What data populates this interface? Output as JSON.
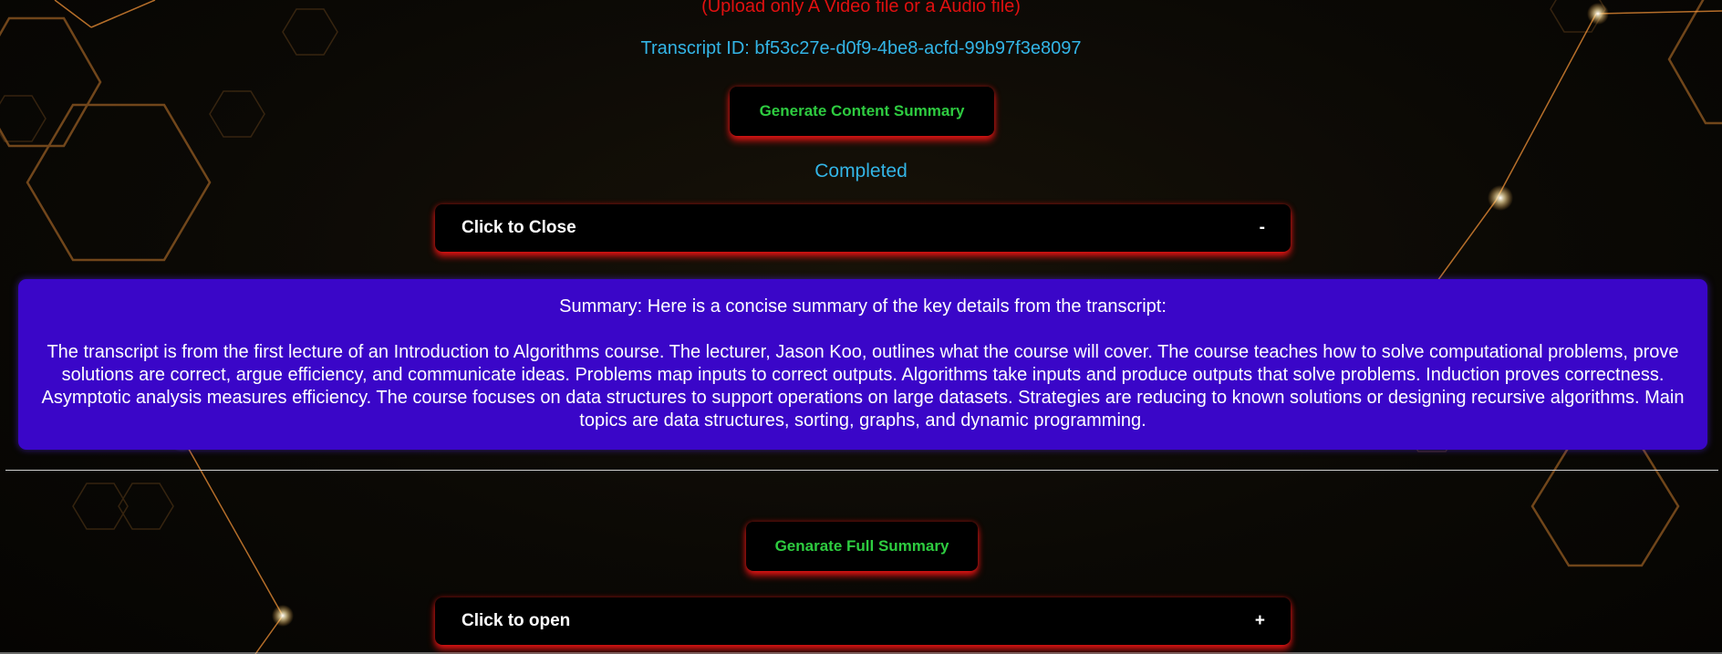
{
  "upload_note": "(Upload only A Video file or a Audio file)",
  "transcript_id": "Transcript ID: bf53c27e-d0f9-4be8-acfd-99b97f3e8097",
  "buttons": {
    "generate_content_summary": "Generate Content Summary",
    "generate_full_summary": "Genarate Full Summary"
  },
  "status": "Completed",
  "accordion_close": {
    "label": "Click to Close",
    "toggle": "-"
  },
  "summary": {
    "title": "Summary: Here is a concise summary of the key details from the transcript:",
    "body": "The transcript is from the first lecture of an Introduction to Algorithms course. The lecturer, Jason Koo, outlines what the course will cover. The course teaches how to solve computational problems, prove solutions are correct, argue efficiency, and communicate ideas. Problems map inputs to correct outputs. Algorithms take inputs and produce outputs that solve problems. Induction proves correctness. Asymptotic analysis measures efficiency. The course focuses on data structures to support operations on large datasets. Strategies are reducing to known solutions or designing recursive algorithms. Main topics are data structures, sorting, graphs, and dynamic programming."
  },
  "accordion_open": {
    "label": "Click to open",
    "toggle": "+"
  },
  "colors": {
    "warning_text": "#e01010",
    "info_text": "#33b5e6",
    "button_text": "#2ecc40",
    "summary_background": "#3a06c8",
    "glow": "#e61414",
    "background": "#0b0905"
  }
}
